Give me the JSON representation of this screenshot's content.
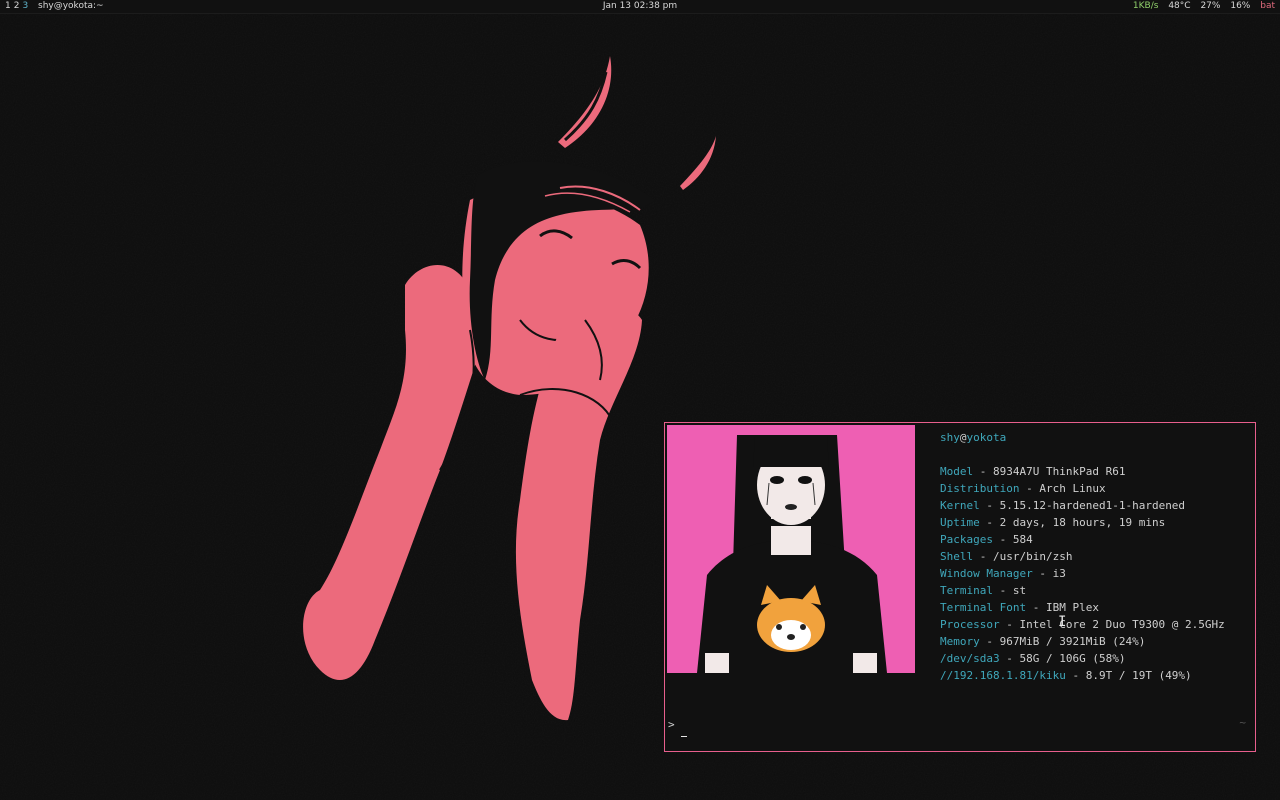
{
  "bar": {
    "workspaces": [
      "1",
      "2",
      "3"
    ],
    "active_workspace": "3",
    "window_title": "shy@yokota:~",
    "clock": "Jan 13 02:38 pm",
    "net": "1KB/s",
    "temp": "48°C",
    "cpu": "27%",
    "volume": "16%",
    "battery": "bat"
  },
  "terminal": {
    "user": "shy",
    "at": "@",
    "host": "yokota",
    "info": [
      {
        "key": "Model",
        "value": "8934A7U ThinkPad R61"
      },
      {
        "key": "Distribution",
        "value": "Arch Linux"
      },
      {
        "key": "Kernel",
        "value": "5.15.12-hardened1-1-hardened"
      },
      {
        "key": "Uptime",
        "value": "2 days, 18 hours, 19 mins"
      },
      {
        "key": "Packages",
        "value": "584"
      },
      {
        "key": "Shell",
        "value": "/usr/bin/zsh"
      },
      {
        "key": "Window Manager",
        "value": "i3"
      },
      {
        "key": "Terminal",
        "value": "st"
      },
      {
        "key": "Terminal Font",
        "value": "IBM Plex"
      },
      {
        "key": "Processor",
        "value": "Intel Core 2 Duo T9300 @ 2.5GHz"
      },
      {
        "key": "Memory",
        "value": "967MiB / 3921MiB (24%)"
      },
      {
        "key": "/dev/sda3",
        "value": "58G / 106G (58%)"
      },
      {
        "key": "//192.168.1.81/kiku",
        "value": "8.9T / 19T (49%)"
      }
    ],
    "separator": " - ",
    "prompt": ">",
    "right_indicator": "~"
  },
  "colors": {
    "accent_cyan": "#3fa7bb",
    "accent_pink": "#e85f8d",
    "wallpaper_figure": "#ec6a7c",
    "background": "#0c0c0c"
  },
  "icons": {
    "wallpaper": "demon-girl-illustration",
    "terminal_art": "goth-girl-red-panda-portrait",
    "cursor": "text-cursor-icon"
  }
}
